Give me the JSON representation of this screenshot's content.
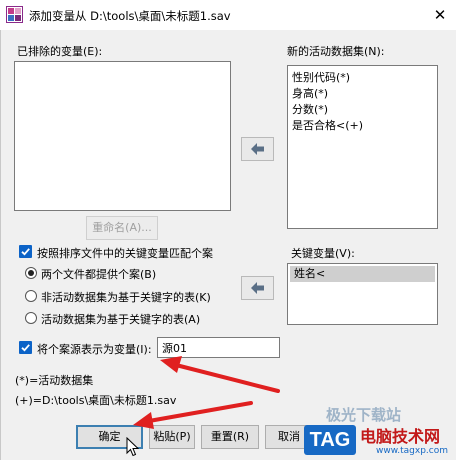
{
  "window": {
    "title": "添加变量从 D:\\tools\\桌面\\未标题1.sav",
    "close_glyph": "✕"
  },
  "excluded": {
    "label": "已排除的变量(E):",
    "items": []
  },
  "rename_label": "重命名(A)...",
  "active": {
    "label": "新的活动数据集(N):",
    "items": [
      "性别代码(*)",
      "身高(*)",
      "分数(*)",
      "是否合格<(+)"
    ]
  },
  "key": {
    "label": "关键变量(V):",
    "items": [
      "姓名<"
    ]
  },
  "match_checkbox": {
    "label": "按照排序文件中的关键变量匹配个案",
    "checked": true
  },
  "radios": [
    {
      "label": "两个文件都提供个案(B)",
      "selected": true
    },
    {
      "label": "非活动数据集为基于关键字的表(K)",
      "selected": false
    },
    {
      "label": "活动数据集为基于关键字的表(A)",
      "selected": false
    }
  ],
  "source_checkbox": {
    "label": "将个案源表示为变量(I):",
    "checked": true
  },
  "source_value": "源01",
  "notes": {
    "star": "(*)=活动数据集",
    "plus": "(+)=D:\\tools\\桌面\\未标题1.sav"
  },
  "buttons": {
    "ok": "确定",
    "paste": "粘贴(P)",
    "reset": "重置(R)",
    "cancel": "取消"
  },
  "watermark": {
    "badge": "TAG",
    "site": "电脑技术网",
    "url": "www.tagxp.com",
    "faint": "极光下载站"
  },
  "colors": {
    "accent": "#0c63c7",
    "annotation_arrow": "#e02020",
    "watermark_blue": "#1769c4",
    "watermark_red": "#c21919"
  }
}
